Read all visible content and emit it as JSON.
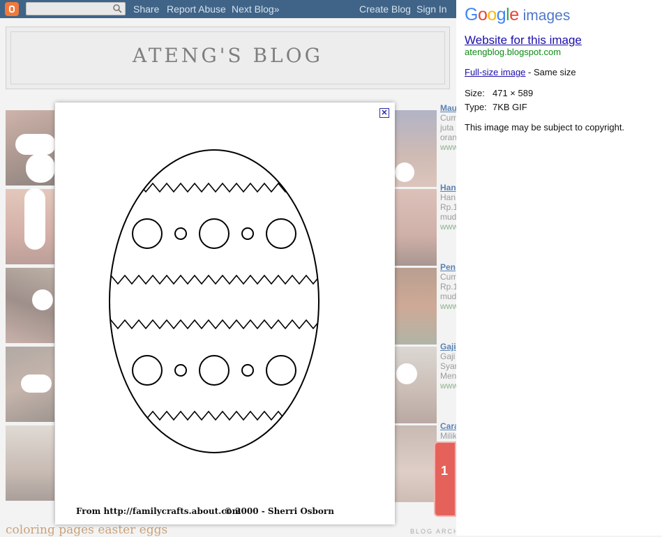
{
  "navbar": {
    "search_placeholder": "",
    "share": "Share",
    "report_abuse": "Report Abuse",
    "next_blog": "Next Blog»",
    "create_blog": "Create Blog",
    "sign_in": "Sign In"
  },
  "blog": {
    "title": "ATENG'S BLOG",
    "post_title": "coloring pages easter eggs",
    "archive_label": "BLOG ARCH",
    "badge_text": "1",
    "sidebar_posts": [
      {
        "title": "Mau",
        "lines": [
          "Cum",
          "juta",
          "oran"
        ],
        "url": "www"
      },
      {
        "title": "Han",
        "lines": [
          "Han",
          "Rp.1",
          "mud"
        ],
        "url": "www"
      },
      {
        "title": "Pen",
        "lines": [
          "Cum",
          "Rp.1",
          "mud"
        ],
        "url": "www"
      },
      {
        "title": "Gaji",
        "lines": [
          "Gaji",
          "Syar",
          "Men"
        ],
        "url": "www"
      },
      {
        "title": "Cara",
        "lines": [
          "Milik"
        ],
        "url": ""
      }
    ]
  },
  "lightbox": {
    "close_label": "✕",
    "credit_left": "From  http://familycrafts.about.com",
    "credit_right": "© 2000 - Sherri Osborn"
  },
  "panel": {
    "logo_google": "Google",
    "logo_images": "images",
    "website_link": "Website for this image",
    "domain": "atengblog.blogspot.com",
    "fullsize_link": "Full-size image",
    "fullsize_note": " - Same size",
    "size_label": "Size:",
    "size_value": "471 × 589",
    "type_label": "Type:",
    "type_value": "7KB GIF",
    "copyright": "This image may be subject to copyright."
  },
  "colors": {
    "navbar": "#3f6487",
    "google_blue": "#4285f4",
    "google_red": "#ea4335",
    "google_yellow": "#fbbc05",
    "google_green": "#34a853",
    "link": "#1a0dab",
    "domain_green": "#0e8a16"
  }
}
